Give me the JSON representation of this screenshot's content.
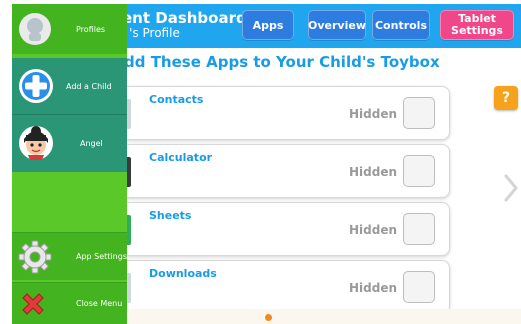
{
  "header": {
    "title": "ent Dashboard",
    "subtitle": "l 's Profile",
    "buttons": {
      "apps": "Apps",
      "overview": "Overview",
      "controls": "Controls",
      "tablet_settings": "Tablet Settings"
    }
  },
  "section_title": "dd These Apps to Your Child's Toybox",
  "apps": [
    {
      "name": "Contacts",
      "state": "Hidden"
    },
    {
      "name": "Calculator",
      "state": "Hidden"
    },
    {
      "name": "Sheets",
      "state": "Hidden"
    },
    {
      "name": "Downloads",
      "state": "Hidden"
    }
  ],
  "help_label": "?",
  "sidebar": {
    "profiles": "Profiles",
    "add_child": "Add a Child",
    "angel": "Angel",
    "app_settings": "App Settings",
    "close_menu": "Close Menu"
  },
  "colors": {
    "header": "#1fa6ee",
    "sidebar": "#5ac828",
    "sidebar_selected": "#2a9676",
    "pink_button": "#f0468a",
    "blue_button": "#2d7de0",
    "help": "#f7a21b"
  },
  "icons": [
    "avatar-icon",
    "plus-icon",
    "child-avatar-icon",
    "gear-icon",
    "close-x-icon",
    "chevron-right-icon"
  ]
}
